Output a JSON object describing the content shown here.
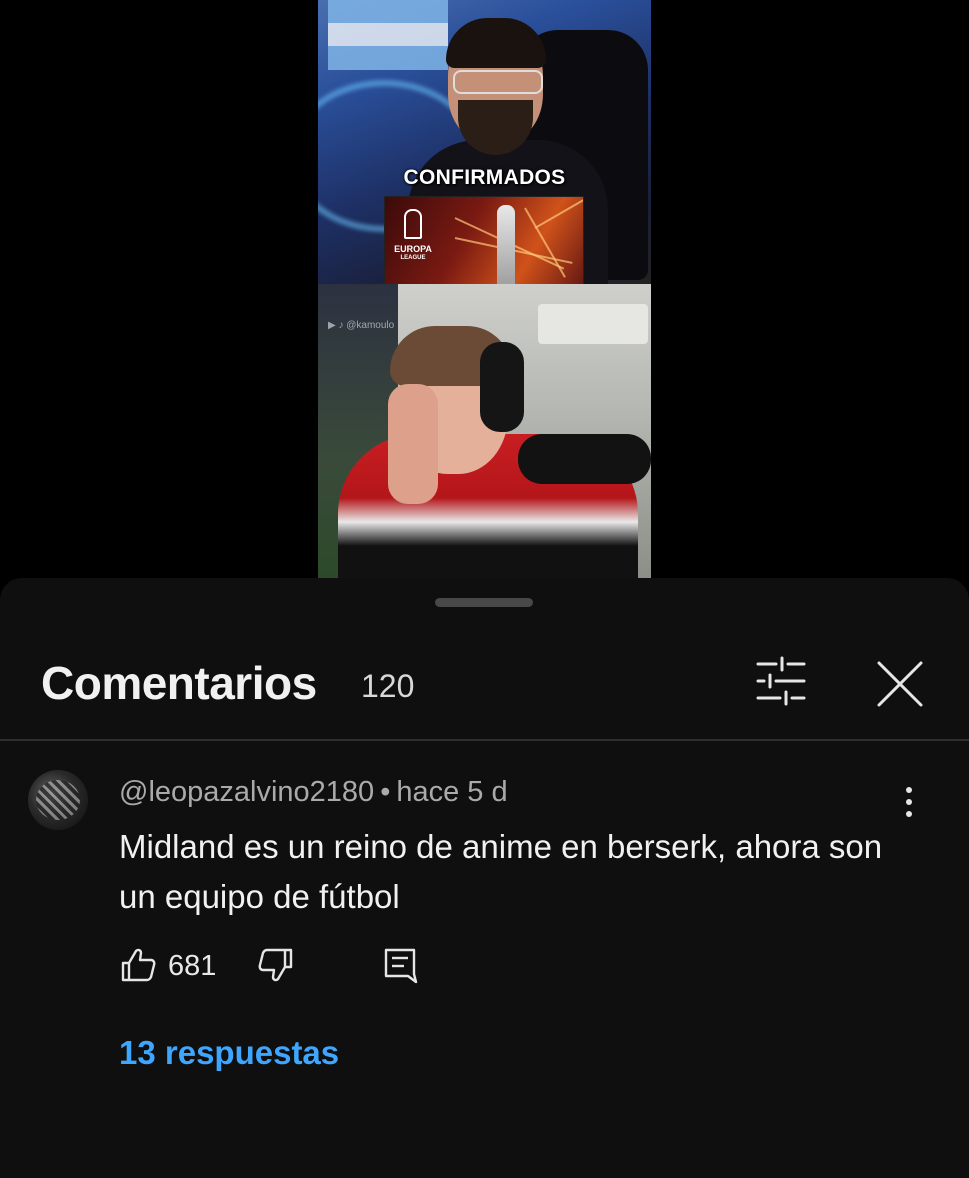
{
  "video": {
    "overlay_text": "CONFIRMADOS",
    "promo_logo_text": "EUROPA",
    "promo_logo_sub": "LEAGUE",
    "watermark": "@kamoulo"
  },
  "comments_sheet": {
    "title": "Comentarios",
    "count": "120",
    "icons": {
      "filter": "sliders-icon",
      "close": "close-icon"
    }
  },
  "comment": {
    "author": "@leopazalvino2180",
    "separator": "•",
    "time": "hace 5 d",
    "text": "Midland es un reino de anime en berserk, ahora son un equipo de fútbol",
    "likes": "681",
    "replies_label": "13 respuestas",
    "icons": {
      "like": "thumbs-up-icon",
      "dislike": "thumbs-down-icon",
      "reply": "reply-comment-icon",
      "more": "more-vertical-icon"
    }
  },
  "colors": {
    "sheet_bg": "#0f0f0f",
    "link": "#3ea6ff",
    "text_primary": "#f1f1f1",
    "text_secondary": "#aaaaaa"
  }
}
